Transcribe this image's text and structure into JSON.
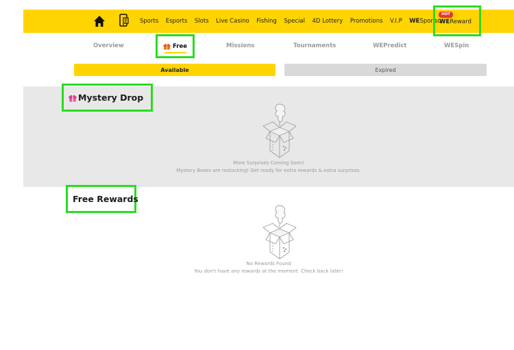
{
  "nav": {
    "items": [
      "Sports",
      "Esports",
      "Slots",
      "Live Casino",
      "Fishing",
      "Special",
      "4D Lottery",
      "Promotions",
      "V.I.P"
    ],
    "wesponsor_prefix": "WE",
    "wesponsor_suffix": "Sponsor",
    "wereward_badge": "HOT",
    "wereward_prefix": "WE",
    "wereward_suffix": "Reward"
  },
  "subtabs": {
    "overview": "Overview",
    "free": "Free",
    "missions": "Missions",
    "tournaments": "Tournaments",
    "wepredict": "WEPredict",
    "wespin": "WESpin"
  },
  "toggle": {
    "available": "Available",
    "expired": "Expired"
  },
  "mystery": {
    "title": "Mystery Drop",
    "line1": "More Surprises Coming Soon!",
    "line2": "Mystery Boxes are restocking! Get ready for extra rewards & extra surprises."
  },
  "free_rewards": {
    "title": "Free Rewards",
    "line1": "No Rewards Found",
    "line2": "You don't have any rewards at the moment. Check back later!"
  },
  "colors": {
    "accent": "#ffd400",
    "highlight": "#2bdb1f",
    "hot_badge": "#e8352c"
  }
}
